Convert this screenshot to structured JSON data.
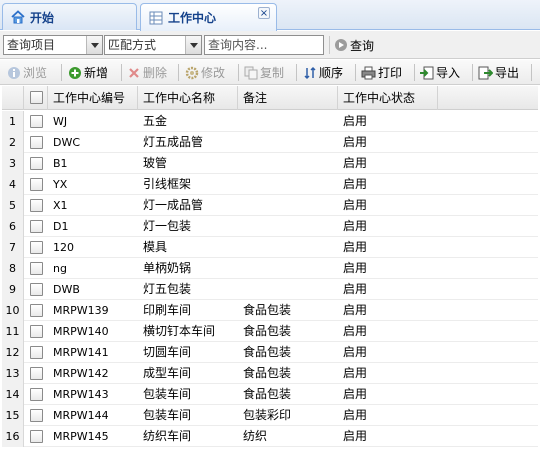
{
  "tabs": [
    {
      "label": "开始",
      "icon": "home-icon"
    },
    {
      "label": "工作中心",
      "icon": "grid-page-icon",
      "close": "×"
    }
  ],
  "search": {
    "field_select": "查询项目",
    "match_select": "匹配方式",
    "placeholder": "查询内容...",
    "query_label": "查询"
  },
  "toolbar": {
    "browse": "浏览",
    "add": "新增",
    "delete": "删除",
    "edit": "修改",
    "copy": "复制",
    "order": "顺序",
    "print": "打印",
    "import": "导入",
    "export": "导出"
  },
  "columns": [
    "工作中心编号",
    "工作中心名称",
    "备注",
    "工作中心状态"
  ],
  "rows": [
    {
      "n": "1",
      "code": "WJ",
      "name": "五金",
      "note": "",
      "status": "启用"
    },
    {
      "n": "2",
      "code": "DWC",
      "name": "灯五成品管",
      "note": "",
      "status": "启用"
    },
    {
      "n": "3",
      "code": "B1",
      "name": "玻管",
      "note": "",
      "status": "启用"
    },
    {
      "n": "4",
      "code": "YX",
      "name": "引线框架",
      "note": "",
      "status": "启用"
    },
    {
      "n": "5",
      "code": "X1",
      "name": "灯一成品管",
      "note": "",
      "status": "启用"
    },
    {
      "n": "6",
      "code": "D1",
      "name": "灯一包装",
      "note": "",
      "status": "启用"
    },
    {
      "n": "7",
      "code": "120",
      "name": "模具",
      "note": "",
      "status": "启用"
    },
    {
      "n": "8",
      "code": "ng",
      "name": "单柄奶锅",
      "note": "",
      "status": "启用"
    },
    {
      "n": "9",
      "code": "DWB",
      "name": "灯五包装",
      "note": "",
      "status": "启用"
    },
    {
      "n": "10",
      "code": "MRPW139",
      "name": "印刷车间",
      "note": "食品包装",
      "status": "启用"
    },
    {
      "n": "11",
      "code": "MRPW140",
      "name": "横切钉本车间",
      "note": "食品包装",
      "status": "启用"
    },
    {
      "n": "12",
      "code": "MRPW141",
      "name": "切圆车间",
      "note": "食品包装",
      "status": "启用"
    },
    {
      "n": "13",
      "code": "MRPW142",
      "name": "成型车间",
      "note": "食品包装",
      "status": "启用"
    },
    {
      "n": "14",
      "code": "MRPW143",
      "name": "包装车间",
      "note": "食品包装",
      "status": "启用"
    },
    {
      "n": "15",
      "code": "MRPW144",
      "name": "包装车间",
      "note": "包装彩印",
      "status": "启用"
    },
    {
      "n": "16",
      "code": "MRPW145",
      "name": "纺织车间",
      "note": "纺织",
      "status": "启用"
    }
  ]
}
